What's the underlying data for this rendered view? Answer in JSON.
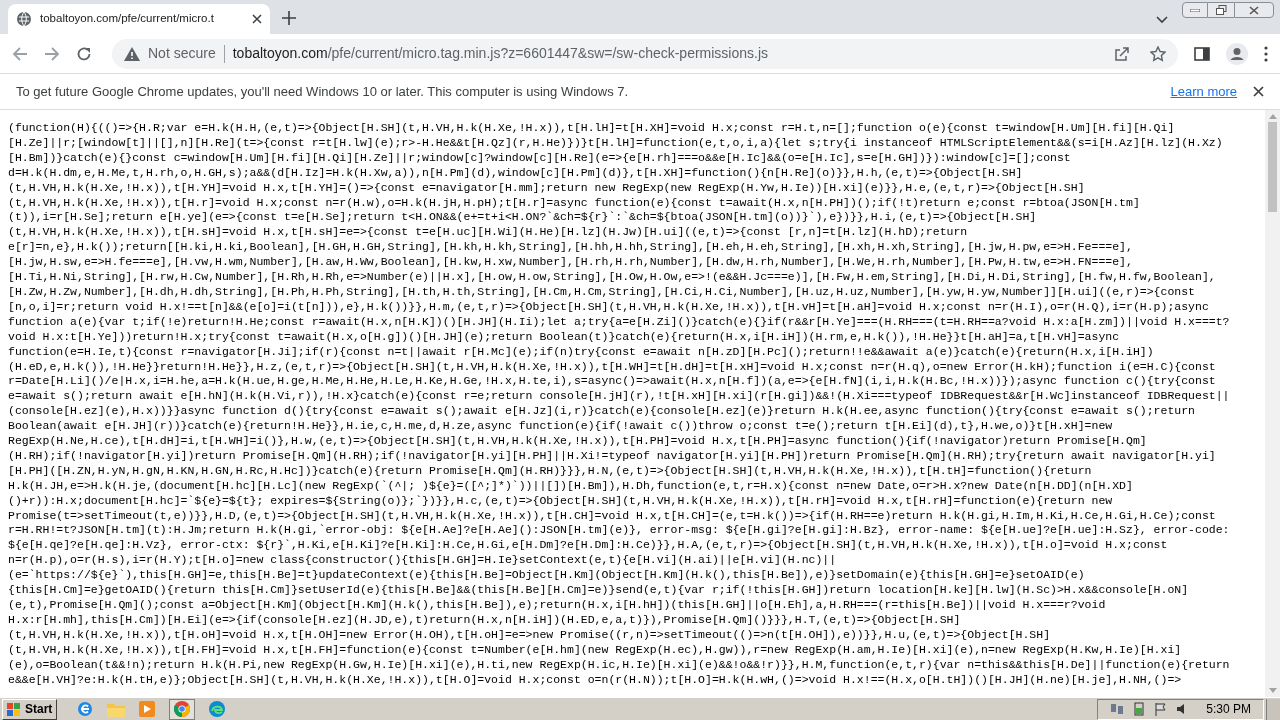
{
  "tab": {
    "title": "tobaltoyon.com/pfe/current/micro.t"
  },
  "address_bar": {
    "security": "Not secure",
    "domain": "tobaltoyon.com",
    "path": "/pfe/current/micro.tag.min.js?z=6601447&sw=/sw-check-permissions.js"
  },
  "infobar": {
    "message": "To get future Google Chrome updates, you'll need Windows 10 or later. This computer is using Windows 7.",
    "link": "Learn more"
  },
  "code_lines": [
    "(function(H){(()=>{H.R;var e=H.k(H.H,(e,t)=>{Object[H.SH](t,H.VH,H.k(H.Xe,!H.x)),t[H.lH]=t[H.XH]=void H.x;const r=H.t,n=[];function o(e){const t=window[H.Um][H.fi][H.Qi]",
    "[H.Ze]||r;[window[t]||[],n][H.Re](t=>{const r=t[H.lw](e);r>-H.He&&t[H.Qz](r,H.He)})}t[H.lH]=function(e,t,o,i,a){let s;try{i instanceof HTMLScriptElement&&(s=i[H.Az][H.lz](H.Xz)",
    "[H.Bm])}catch(e){}const c=window[H.Um][H.fi][H.Qi][H.Ze]||r;window[c]?window[c][H.Re](e=>{e[H.rh]===o&&e[H.Ic]&&(o=e[H.Ic],s=e[H.GH])}):window[c]=[];const",
    "d=H.k(H.dm,e,H.Me,t,H.rh,o,H.GH,s);a&&(d[H.Iz]=H.k(H.Xw,a)),n[H.Pm](d),window[c][H.Pm](d)},t[H.XH]=function(){n[H.Re](o)}},H.h,(e,t)=>{Object[H.SH]",
    "(t,H.VH,H.k(H.Xe,!H.x)),t[H.YH]=void H.x,t[H.YH]=()=>{const e=navigator[H.mm];return new RegExp(new RegExp(H.Yw,H.Ie))[H.xi](e)}},H.e,(e,t,r)=>{Object[H.SH]",
    "(t,H.VH,H.k(H.Xe,!H.x)),t[H.r]=void H.x;const n=r(H.w),o=H.k(H.jH,H.pH);t[H.r]=async function(e){const t=await(H.x,n[H.PH])();if(!t)return e;const r=btoa(JSON[H.tm]",
    "(t)),i=r[H.Se];return e[H.ye](e=>{const t=e[H.Se];return t<H.ON&&(e+=t+i<H.ON?`&ch=${r}`:`&ch=${btoa(JSON[H.tm](o))}`),e})}},H.i,(e,t)=>{Object[H.SH]",
    "(t,H.VH,H.k(H.Xe,!H.x)),t[H.sH]=void H.x,t[H.sH]=e=>{const t=e[H.uc][H.Wi](H.He)[H.lz](H.Jw)[H.ui]((e,t)=>{const [r,n]=t[H.lz](H.hD);return",
    "e[r]=n,e},H.k());return[[H.ki,H.ki,Boolean],[H.GH,H.GH,String],[H.kh,H.kh,String],[H.hh,H.hh,String],[H.eh,H.eh,String],[H.xh,H.xh,String],[H.jw,H.pw,e=>H.Fe===e],",
    "[H.jw,H.sw,e=>H.fe===e],[H.vw,H.wm,Number],[H.aw,H.Ww,Boolean],[H.kw,H.xw,Number],[H.rh,H.rh,Number],[H.dw,H.rh,Number],[H.We,H.rh,Number],[H.Pw,H.tw,e=>H.FN===e],",
    "[H.Ti,H.Ni,String],[H.rw,H.Cw,Number],[H.Rh,H.Rh,e=>Number(e)||H.x],[H.ow,H.ow,String],[H.Ow,H.Ow,e=>!(e&&H.Jc===e)],[H.Fw,H.em,String],[H.Di,H.Di,String],[H.fw,H.fw,Boolean],",
    "[H.Zw,H.Zw,Number],[H.dh,H.dh,String],[H.Ph,H.Ph,String],[H.th,H.th,String],[H.Cm,H.Cm,String],[H.Ci,H.Ci,Number],[H.uz,H.uz,Number],[H.yw,H.yw,Number]][H.ui]((e,r)=>{const",
    "[n,o,i]=r;return void H.x!==t[n]&&(e[o]=i(t[n])),e},H.k())}},H.m,(e,t,r)=>{Object[H.SH](t,H.VH,H.k(H.Xe,!H.x)),t[H.vH]=t[H.aH]=void H.x;const n=r(H.I),o=r(H.Q),i=r(H.p);async",
    "function a(e){var t;if(!e)return!H.He;const r=await(H.x,n[H.K])()[H.JH](H.Ii);let a;try{a=e[H.Zi]()}catch(e){}if(r&&r[H.Ye]===(H.RH===(t=H.RH==a?void H.x:a[H.zm])||void H.x===t?",
    "void H.x:t[H.Ye]))return!H.x;try{const t=await(H.x,o[H.g])()[H.JH](e);return Boolean(t)}catch(e){return(H.x,i[H.iH])(H.rm,e,H.k()),!H.He}}t[H.aH]=a,t[H.vH]=async",
    "function(e=H.Ie,t){const r=navigator[H.Ji];if(r){const n=t||await r[H.Mc](e);if(n)try{const e=await n[H.zD][H.Pc]();return!!e&&await a(e)}catch(e){return(H.x,i[H.iH])",
    "(H.eD,e,H.k()),!H.He}}return!H.He}},H.z,(e,t,r)=>{Object[H.SH](t,H.VH,H.k(H.Xe,!H.x)),t[H.WH]=t[H.dH]=t[H.xH]=void H.x;const n=r(H.q),o=new Error(H.kH);function i(e=H.C){const",
    "r=Date[H.Li]()/e|H.x,i=H.he,a=H.k(H.ue,H.ge,H.Me,H.He,H.Le,H.Ke,H.Ge,!H.x,H.te,i),s=async()=>await(H.x,n[H.f])(a,e=>{e[H.fN](i,i,H.k(H.Bc,!H.x))});async function c(){try{const",
    "e=await s();return await e[H.hN](H.k(H.Vi,r)),!H.x}catch(e){const r=e;return console[H.jH](r),!t[H.xH][H.xi](r[H.gi])&&!(H.Xi===typeof IDBRequest&&r[H.Wc]instanceof IDBRequest||",
    "(console[H.ez](e),H.x))}}async function d(){try{const e=await s();await e[H.Jz](i,r)}catch(e){console[H.ez](e)}return H.k(H.ee,async function(){try{const e=await s();return",
    "Boolean(await e[H.JH](r))}catch(e){return!H.He}},H.ie,c,H.me,d,H.ze,async function(e){if(!await c())throw o;const t=e();return t[H.Ei](d),t},H.we,o)}t[H.xH]=new",
    "RegExp(H.Ne,H.ce),t[H.dH]=i,t[H.WH]=i()},H.w,(e,t)=>{Object[H.SH](t,H.VH,H.k(H.Xe,!H.x)),t[H.PH]=void H.x,t[H.PH]=async function(){if(!navigator)return Promise[H.Qm]",
    "(H.RH);if(!navigator[H.yi])return Promise[H.Qm](H.RH);if(!navigator[H.yi][H.PH]||H.Xi!=typeof navigator[H.yi][H.PH])return Promise[H.Qm](H.RH);try{return await navigator[H.yi]",
    "[H.PH]([H.ZN,H.yN,H.gN,H.KN,H.GN,H.Rc,H.Hc])}catch(e){return Promise[H.Qm](H.RH)}}},H.N,(e,t)=>{Object[H.SH](t,H.VH,H.k(H.Xe,!H.x)),t[H.tH]=function(){return",
    "H.k(H.JH,e=>H.k(H.je,(document[H.hc][H.Lc](new RegExp(`(^|; )${e}=([^;]*)`))||[])[H.Bm]),H.Dh,function(e,t,r=H.x){const n=new Date,o=r>H.x?new Date(n[H.DD](n[H.XD]",
    "()+r)):H.x;document[H.hc]=`${e}=${t}; expires=${String(o)};`})}},H.c,(e,t)=>{Object[H.SH](t,H.VH,H.k(H.Xe,!H.x)),t[H.rH]=void H.x,t[H.rH]=function(e){return new",
    "Promise(t=>setTimeout(t,e))}},H.D,(e,t)=>{Object[H.SH](t,H.VH,H.k(H.Xe,!H.x)),t[H.CH]=void H.x,t[H.CH]=(e,t=H.k())=>{if(H.RH==e)return H.k(H.gi,H.Im,H.Ki,H.Ce,H.Gi,H.Ce);const",
    "r=H.RH!=t?JSON[H.tm](t):H.Jm;return H.k(H.gi,`error-obj: ${e[H.Ae]?e[H.Ae]():JSON[H.tm](e)}, error-msg: ${e[H.gi]?e[H.gi]:H.Bz}, error-name: ${e[H.ue]?e[H.ue]:H.Sz}, error-code:",
    "${e[H.qe]?e[H.qe]:H.Vz}, error-ctx: ${r}`,H.Ki,e[H.Ki]?e[H.Ki]:H.Ce,H.Gi,e[H.Dm]?e[H.Dm]:H.Ce)}},H.A,(e,t,r)=>{Object[H.SH](t,H.VH,H.k(H.Xe,!H.x)),t[H.o]=void H.x;const",
    "n=r(H.p),o=r(H.s),i=r(H.Y);t[H.o]=new class{constructor(){this[H.GH]=H.Ie}setContext(e,t){e[H.vi](H.ai)||e[H.vi](H.nc)||",
    "(e=`https://${e}`),this[H.GH]=e,this[H.Be]=t}updateContext(e){this[H.Be]=Object[H.Km](Object[H.Km](H.k(),this[H.Be]),e)}setDomain(e){this[H.GH]=e}setOAID(e)",
    "{this[H.Cm]=e}getOAID(){return this[H.Cm]}setUserId(e){this[H.Be]&&(this[H.Be][H.Cm]=e)}send(e,t){var r;if(!this[H.GH])return location[H.ke][H.lw](H.Sc)>H.x&&console[H.oN]",
    "(e,t),Promise[H.Qm]();const a=Object[H.Km](Object[H.Km](H.k(),this[H.Be]),e);return(H.x,i[H.hH])(this[H.GH]||o[H.Eh],a,H.RH===(r=this[H.Be])||void H.x===r?void",
    "H.x:r[H.mh],this[H.Cm])[H.Ei](e=>{if(console[H.ez](H.JD,e),t)return(H.x,n[H.iH])(H.ED,e,a,t)}),Promise[H.Qm]()}}},H.T,(e,t)=>{Object[H.SH]",
    "(t,H.VH,H.k(H.Xe,!H.x)),t[H.oH]=void H.x,t[H.OH]=new Error(H.OH),t[H.oH]=e=>new Promise((r,n)=>setTimeout(()=>n(t[H.OH]),e))}},H.u,(e,t)=>{Object[H.SH]",
    "(t,H.VH,H.k(H.Xe,!H.x)),t[H.FH]=void H.x,t[H.FH]=function(e){const t=Number(e[H.hm](new RegExp(H.ec),H.gw)),r=new RegExp(H.am,H.Ie)[H.xi](e),n=new RegExp(H.Kw,H.Ie)[H.xi]",
    "(e),o=Boolean(t&&!n);return H.k(H.Pi,new RegExp(H.Gw,H.Ie)[H.xi](e),H.ti,new RegExp(H.ic,H.Ie)[H.xi](e)&&!o&&!r)}},H.M,function(e,t,r){var n=this&&this[H.De]||function(e){return",
    "e&&e[H.VH]?e:H.k(H.tH,e)};Object[H.SH](t,H.VH,H.k(H.Xe,!H.x)),t[H.O]=void H.x;const o=n(r(H.N));t[H.O]=H.k(H.wH,()=>void H.x!==(H.x,o[H.tH])()[H.JH](H.ne)[H.je],H.NH,()=>"
  ],
  "taskbar": {
    "start": "Start",
    "clock": "5:30 PM"
  }
}
